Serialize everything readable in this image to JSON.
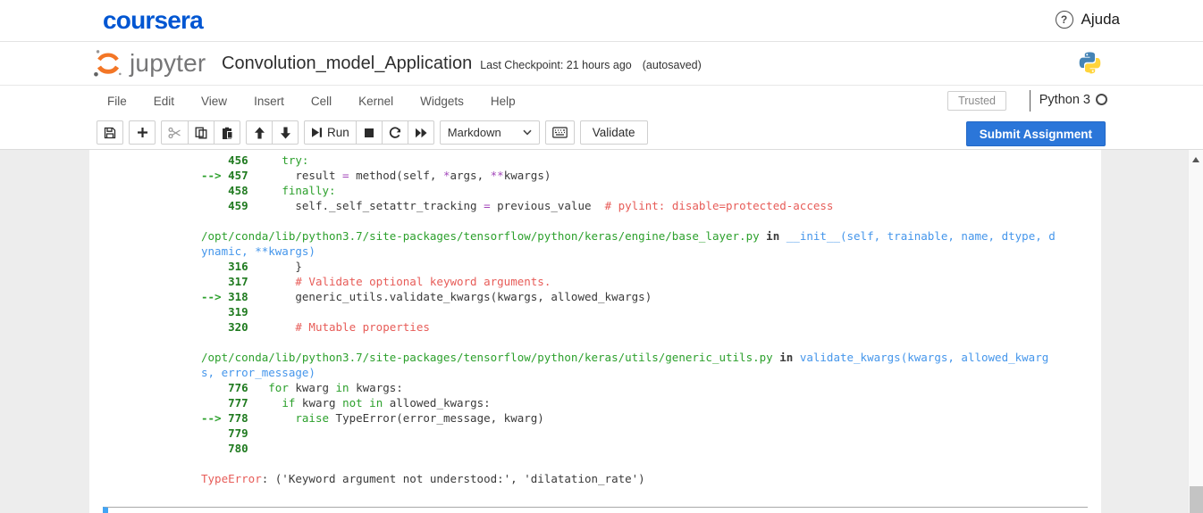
{
  "topbar": {
    "brand": "coursera",
    "help": "Ajuda"
  },
  "header": {
    "logo_text": "jupyter",
    "title": "Convolution_model_Application",
    "checkpoint": "Last Checkpoint: 21 hours ago",
    "autosave": "(autosaved)"
  },
  "menubar": {
    "items": [
      "File",
      "Edit",
      "View",
      "Insert",
      "Cell",
      "Kernel",
      "Widgets",
      "Help"
    ],
    "trusted": "Trusted",
    "kernel_name": "Python 3"
  },
  "toolbar": {
    "run": "Run",
    "cell_type": "Markdown",
    "validate": "Validate",
    "submit": "Submit Assignment"
  },
  "colors": {
    "coursera_blue": "#0056d2",
    "submit_blue": "#2b76d9",
    "jupyter_orange": "#f37626",
    "ansi_green": "#2ca02c",
    "ansi_red": "#e75c58",
    "ansi_blue": "#4596eb",
    "ansi_purple": "#a347ba",
    "selected_cell_blue": "#42a5f5"
  },
  "traceback": {
    "lines": [
      [
        [
          "n",
          "    456"
        ],
        [
          "t",
          "     "
        ],
        [
          "g",
          "try:"
        ]
      ],
      [
        [
          "a",
          "--> "
        ],
        [
          "n",
          "457"
        ],
        [
          "t",
          "       result "
        ],
        [
          "p",
          "="
        ],
        [
          "t",
          " method(self, "
        ],
        [
          "p",
          "*"
        ],
        [
          "t",
          "args, "
        ],
        [
          "p",
          "**"
        ],
        [
          "t",
          "kwargs)"
        ]
      ],
      [
        [
          "n",
          "    458"
        ],
        [
          "t",
          "     "
        ],
        [
          "g",
          "finally:"
        ]
      ],
      [
        [
          "n",
          "    459"
        ],
        [
          "t",
          "       self._self_setattr_tracking "
        ],
        [
          "p",
          "="
        ],
        [
          "t",
          " previous_value  "
        ],
        [
          "r",
          "# pylint: disable=protected-access"
        ]
      ],
      [],
      [
        [
          "g",
          "/opt/conda/lib/python3.7/site-packages/tensorflow/python/keras/engine/base_layer.py"
        ],
        [
          "t",
          " "
        ],
        [
          "k",
          "in"
        ],
        [
          "t",
          " "
        ],
        [
          "b",
          "__init__(self, trainable, name, dtype, d"
        ]
      ],
      [
        [
          "b",
          "ynamic, **kwargs)"
        ]
      ],
      [
        [
          "n",
          "    316"
        ],
        [
          "t",
          "       }"
        ]
      ],
      [
        [
          "n",
          "    317"
        ],
        [
          "t",
          "       "
        ],
        [
          "r",
          "# Validate optional keyword arguments."
        ]
      ],
      [
        [
          "a",
          "--> "
        ],
        [
          "n",
          "318"
        ],
        [
          "t",
          "       generic_utils.validate_kwargs(kwargs, allowed_kwargs)"
        ]
      ],
      [
        [
          "n",
          "    319"
        ]
      ],
      [
        [
          "n",
          "    320"
        ],
        [
          "t",
          "       "
        ],
        [
          "r",
          "# Mutable properties"
        ]
      ],
      [],
      [
        [
          "g",
          "/opt/conda/lib/python3.7/site-packages/tensorflow/python/keras/utils/generic_utils.py"
        ],
        [
          "t",
          " "
        ],
        [
          "k",
          "in"
        ],
        [
          "t",
          " "
        ],
        [
          "b",
          "validate_kwargs(kwargs, allowed_kwarg"
        ]
      ],
      [
        [
          "b",
          "s, error_message)"
        ]
      ],
      [
        [
          "n",
          "    776"
        ],
        [
          "t",
          "   "
        ],
        [
          "g",
          "for"
        ],
        [
          "t",
          " kwarg "
        ],
        [
          "g",
          "in"
        ],
        [
          "t",
          " kwargs:"
        ]
      ],
      [
        [
          "n",
          "    777"
        ],
        [
          "t",
          "     "
        ],
        [
          "g",
          "if"
        ],
        [
          "t",
          " kwarg "
        ],
        [
          "g",
          "not in"
        ],
        [
          "t",
          " allowed_kwargs:"
        ]
      ],
      [
        [
          "a",
          "--> "
        ],
        [
          "n",
          "778"
        ],
        [
          "t",
          "       "
        ],
        [
          "g",
          "raise"
        ],
        [
          "t",
          " TypeError(error_message, kwarg)"
        ]
      ],
      [
        [
          "n",
          "    779"
        ]
      ],
      [
        [
          "n",
          "    780"
        ]
      ],
      [],
      [
        [
          "r",
          "TypeError"
        ],
        [
          "t",
          ": ('Keyword argument not understood:', 'dilatation_rate')"
        ]
      ]
    ]
  }
}
